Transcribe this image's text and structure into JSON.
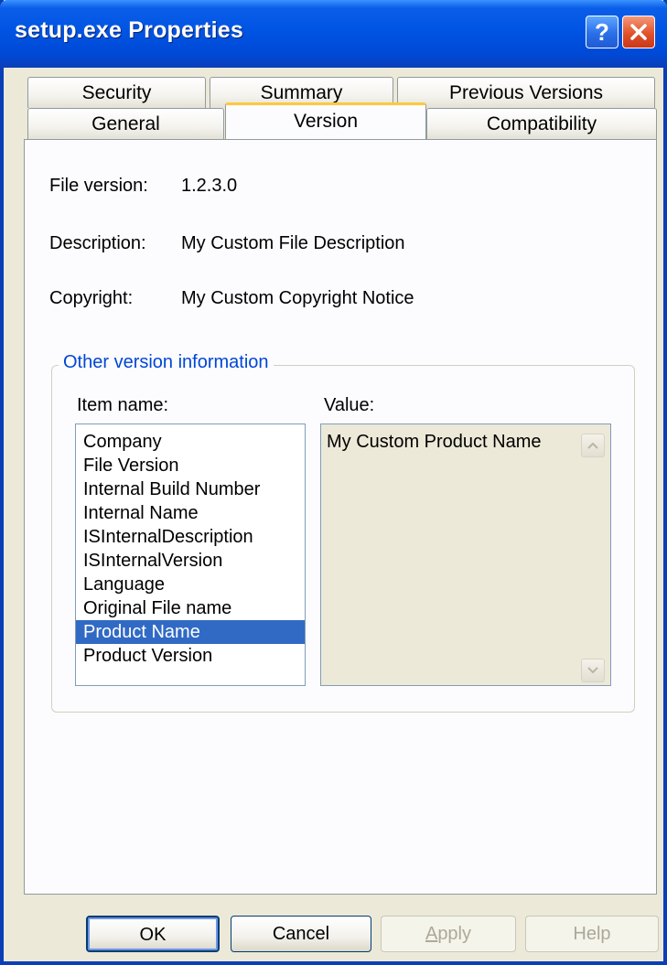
{
  "window": {
    "title": "setup.exe Properties",
    "help_glyph": "?",
    "close_glyph": "×"
  },
  "tabs": {
    "row_back": [
      "Security",
      "Summary",
      "Previous Versions"
    ],
    "row_front": [
      "General",
      "Version",
      "Compatibility"
    ],
    "active": "Version"
  },
  "fields": {
    "file_version_label": "File version:",
    "file_version_value": "1.2.3.0",
    "description_label": "Description:",
    "description_value": "My Custom File Description",
    "copyright_label": "Copyright:",
    "copyright_value": "My Custom Copyright Notice"
  },
  "other_info": {
    "group_title": "Other version information",
    "item_name_label": "Item name:",
    "value_label": "Value:",
    "items": [
      "Company",
      "File Version",
      "Internal Build Number",
      "Internal Name",
      "ISInternalDescription",
      "ISInternalVersion",
      "Language",
      "Original File name",
      "Product Name",
      "Product Version"
    ],
    "selected_item": "Product Name",
    "value_text": "My Custom Product Name"
  },
  "buttons": {
    "ok": "OK",
    "cancel": "Cancel",
    "apply": "Apply",
    "help": "Help"
  },
  "colors": {
    "titlebar": "#0054e3",
    "selection": "#316ac5",
    "group_title": "#0046d5",
    "active_tab_accent": "#ffc83c"
  }
}
